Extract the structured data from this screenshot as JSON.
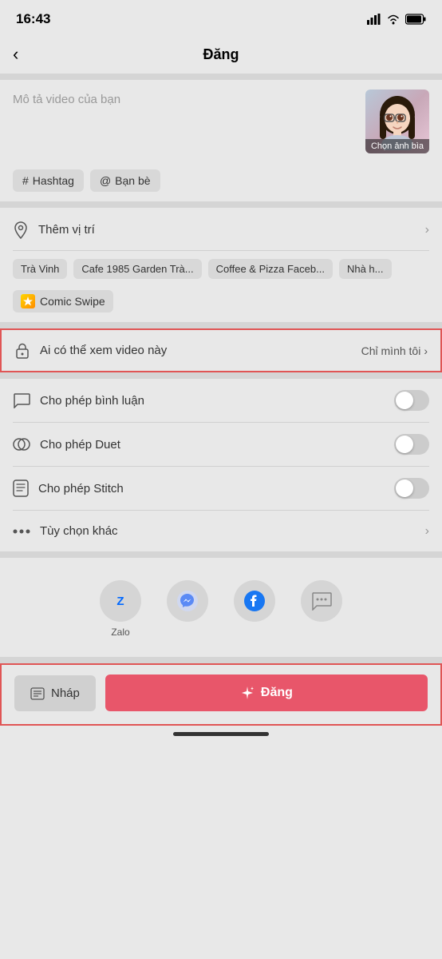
{
  "statusBar": {
    "time": "16:43",
    "signal": "▲▲▲",
    "wifi": "wifi",
    "battery": "battery"
  },
  "header": {
    "back_label": "‹",
    "title": "Đăng"
  },
  "videoSection": {
    "placeholder": "Mô tả video của bạn",
    "cover_label": "Chọn ảnh bìa"
  },
  "tags": [
    {
      "icon": "#",
      "label": "Hashtag"
    },
    {
      "icon": "@",
      "label": "Bạn bè"
    }
  ],
  "location": {
    "icon": "📍",
    "label": "Thêm vị trí",
    "chevron": "›"
  },
  "locationChips": [
    "Trà Vinh",
    "Cafe 1985 Garden Trà...",
    "Coffee & Pizza Faceb...",
    "Nhà h..."
  ],
  "specialChips": [
    {
      "icon": "✦",
      "label": "Comic Swipe"
    }
  ],
  "whoCanView": {
    "icon": "🔒",
    "label": "Ai có thể xem video này",
    "value": "Chỉ mình tôi",
    "chevron": "›"
  },
  "settings": [
    {
      "id": "comments",
      "icon": "💬",
      "label": "Cho phép bình luận",
      "toggle": false
    },
    {
      "id": "duet",
      "icon": "⊙",
      "label": "Cho phép Duet",
      "toggle": false
    },
    {
      "id": "stitch",
      "icon": "⊡",
      "label": "Cho phép Stitch",
      "toggle": false
    },
    {
      "id": "more",
      "icon": "•••",
      "label": "Tùy chọn khác",
      "chevron": "›"
    }
  ],
  "shareIcons": [
    {
      "id": "zalo",
      "label": "Zalo",
      "symbol": "Z"
    },
    {
      "id": "messenger",
      "label": "",
      "symbol": "⚡"
    },
    {
      "id": "facebook",
      "label": "",
      "symbol": "f"
    },
    {
      "id": "message",
      "label": "",
      "symbol": "💬"
    }
  ],
  "bottomButtons": {
    "draft_icon": "⊟",
    "draft_label": "Nháp",
    "post_icon": "✳",
    "post_label": "Đăng"
  }
}
